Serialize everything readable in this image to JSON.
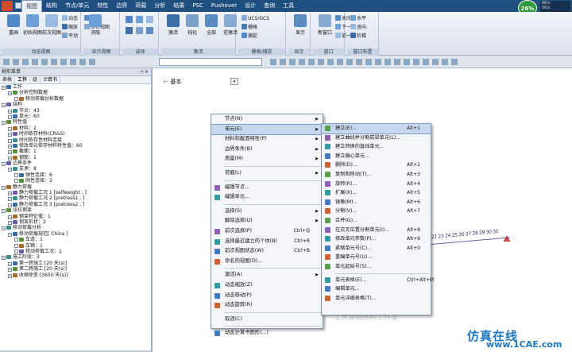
{
  "ribbon_tabs": [
    "视图",
    "结构",
    "节点/单元",
    "特性",
    "边界",
    "荷载",
    "分析",
    "结果",
    "PSC",
    "Pushover",
    "设计",
    "查询",
    "工具"
  ],
  "active_tab": 0,
  "status": {
    "percent": "26%",
    "speed_up": "0K/s",
    "speed_down": "0K/s"
  },
  "ribbon_groups": [
    {
      "label": "动态视图",
      "big": [
        "重画",
        "初始视图",
        "前次视图"
      ],
      "small": [
        "动态",
        "缩放",
        "平动",
        "视点",
        "命名视图"
      ]
    },
    {
      "label": "显示视图",
      "big": [
        "消隐"
      ],
      "small": []
    },
    {
      "label": "选择",
      "big": [],
      "small": []
    },
    {
      "label": "激活",
      "big": [
        "激活",
        "钝化",
        "全部",
        "逆激活"
      ],
      "small": []
    },
    {
      "label": "栅格/捕捉",
      "big": [],
      "small": [
        "UCS/GCS",
        "栅格",
        "捕捉"
      ]
    },
    {
      "label": "显示",
      "big": [
        "显示"
      ],
      "small": []
    },
    {
      "label": "窗口",
      "big": [
        "新窗口"
      ],
      "small": [
        "关闭",
        "下一个",
        "前一个"
      ]
    },
    {
      "label": "窗口布置",
      "big": [],
      "small": [
        "水平",
        "竖向",
        "阶梯"
      ]
    }
  ],
  "left_panel": {
    "title": "树形菜单",
    "tabs": [
      "表格",
      "工作",
      "组",
      "计算书"
    ],
    "active_tab": 1,
    "tree": [
      {
        "d": 0,
        "t": "工作"
      },
      {
        "d": 1,
        "t": "分析控制数据"
      },
      {
        "d": 2,
        "t": "移动荷载分析数据"
      },
      {
        "d": 0,
        "t": "结构"
      },
      {
        "d": 1,
        "t": "节点：43"
      },
      {
        "d": 1,
        "t": "单元：60"
      },
      {
        "d": 0,
        "t": "特性值"
      },
      {
        "d": 1,
        "t": "材料：2"
      },
      {
        "d": 1,
        "t": "时间依存材料(CR&S)"
      },
      {
        "d": 1,
        "t": "时间依存性材料连接"
      },
      {
        "d": 1,
        "t": "修改单元依存材料特性值：60"
      },
      {
        "d": 1,
        "t": "截面：1"
      },
      {
        "d": 1,
        "t": "钢筋：1"
      },
      {
        "d": 0,
        "t": "边界条件"
      },
      {
        "d": 1,
        "t": "支承：8"
      },
      {
        "d": 2,
        "t": "弹性连接：6"
      },
      {
        "d": 2,
        "t": "刚性连接：3"
      },
      {
        "d": 0,
        "t": "静力荷载"
      },
      {
        "d": 1,
        "t": "静力荷载工况 1 [selfweight ; ]"
      },
      {
        "d": 1,
        "t": "静力荷载工况 2 [pretress1 ; ]"
      },
      {
        "d": 1,
        "t": "静力荷载工况 3 [pretress2 ; ]"
      },
      {
        "d": 0,
        "t": "张拉钢束"
      },
      {
        "d": 1,
        "t": "钢束特征值：1"
      },
      {
        "d": 1,
        "t": "钢束形状：2"
      },
      {
        "d": 0,
        "t": "移动荷载分析"
      },
      {
        "d": 1,
        "t": "移动荷载规范[ China ]"
      },
      {
        "d": 2,
        "t": "车道：1"
      },
      {
        "d": 2,
        "t": "车辆：1"
      },
      {
        "d": 2,
        "t": "移动荷载工况：1"
      },
      {
        "d": 0,
        "t": "施工阶段：3"
      },
      {
        "d": 1,
        "t": "第一跨施工 [20 天(s)]"
      },
      {
        "d": 1,
        "t": "第二跨施工 [20 天(s)]"
      },
      {
        "d": 1,
        "t": "收缩徐变 [3650 天(s)]"
      }
    ]
  },
  "canvas": {
    "view_label": "基本",
    "node_numbers": "21 22 23 24 25 26 27 28 29 30 31"
  },
  "context_menu": [
    {
      "label": "节点(N)",
      "arrow": true
    },
    {
      "label": "单元(E)",
      "arrow": true,
      "hl": true
    },
    {
      "label": "材料和截面特性(P)",
      "arrow": true
    },
    {
      "label": "边界条件(B)",
      "arrow": true
    },
    {
      "label": "质量(M)",
      "arrow": true
    },
    {
      "sep": true
    },
    {
      "label": "荷载(L)",
      "arrow": true
    },
    {
      "sep": true
    },
    {
      "label": "编辑节点...",
      "icon": true
    },
    {
      "label": "编辑单元...",
      "icon": true
    },
    {
      "sep": true
    },
    {
      "label": "选择(S)",
      "arrow": true
    },
    {
      "label": "解除选择(U)",
      "arrow": true
    },
    {
      "label": "前次选择(P)",
      "sc": "Ctrl+Q",
      "icon": true
    },
    {
      "label": "选择最近建立的个体(B)",
      "sc": "Ctrl+R",
      "icon": true
    },
    {
      "label": "前次视图状态(W)",
      "sc": "Ctrl+B",
      "icon": true
    },
    {
      "label": "命名的视图(D)...",
      "icon": true
    },
    {
      "sep": true
    },
    {
      "label": "激活(A)",
      "arrow": true
    },
    {
      "label": "动态缩放(Z)",
      "icon": true
    },
    {
      "label": "动态移动(P)",
      "icon": true
    },
    {
      "label": "动态旋转(R)",
      "icon": true
    },
    {
      "sep": true
    },
    {
      "label": "取消(C)"
    },
    {
      "sep": true
    },
    {
      "label": "动态计算书图形(...)",
      "icon": true
    }
  ],
  "submenu": [
    {
      "label": "建立(E)...",
      "sc": "Alt+1",
      "hl": true
    },
    {
      "label": "建立曲线并分割成梁单元(L)..."
    },
    {
      "label": "建立转换的直线单元..."
    },
    {
      "label": "建立偏心单元..."
    },
    {
      "label": "删除(D)...",
      "sc": "Alt+2"
    },
    {
      "label": "复制和移动(T)...",
      "sc": "Alt+3"
    },
    {
      "label": "旋转(R)...",
      "sc": "Alt+4"
    },
    {
      "label": "扩展(X)...",
      "sc": "Alt+5"
    },
    {
      "label": "镜像(M)...",
      "sc": "Alt+6"
    },
    {
      "label": "分割(V)...",
      "sc": "Alt+7"
    },
    {
      "label": "合并(G)..."
    },
    {
      "label": "在交叉位置分割单元(I)...",
      "sc": "Alt+8"
    },
    {
      "label": "修改单元参数(P)...",
      "sc": "Alt+9"
    },
    {
      "label": "紧缩单元号(C)...",
      "sc": "Alt+0"
    },
    {
      "label": "重编单元号(U)..."
    },
    {
      "label": "单元起始号(S)..."
    },
    {
      "sep": true
    },
    {
      "label": "单元表格(E)...",
      "sc": "Ctrl+Alt+M"
    },
    {
      "label": "编辑单元..."
    },
    {
      "label": "单元详细表格(T)..."
    }
  ],
  "watermark": {
    "text": "仿真在线",
    "url": "www.1CAE.com",
    "wechat": "工大建筑结构工作室"
  }
}
